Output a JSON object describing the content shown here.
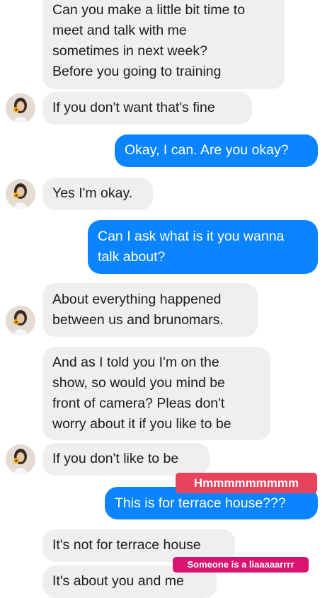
{
  "colors": {
    "incoming_bubble": "#efeff0",
    "outgoing_bubble": "#0a84ff",
    "sticker_red": "#e9425b",
    "sticker_pink": "#d9136e"
  },
  "messages": [
    {
      "from": "them",
      "text": "Can you make a little bit time to\nmeet and talk with me\nsometimes in next week?\nBefore you going to training"
    },
    {
      "from": "them",
      "text": "If you don't want that's fine"
    },
    {
      "from": "me",
      "text": "Okay, I can. Are you okay?"
    },
    {
      "from": "them",
      "text": "Yes I'm okay."
    },
    {
      "from": "me",
      "text": "Can I ask what is it you wanna\ntalk about?"
    },
    {
      "from": "them",
      "text": "About everything happened\nbetween us and brunomars."
    },
    {
      "from": "them",
      "text": "And as I told you I'm on the\nshow, so would you mind be\nfront of camera? Pleas don't\nworry about it if you like to be"
    },
    {
      "from": "them",
      "text": "If you don't like to be"
    },
    {
      "from": "me",
      "text": "This is for terrace house???"
    },
    {
      "from": "them",
      "text": "It's not for terrace house"
    },
    {
      "from": "them",
      "text": "It's about you and me"
    }
  ],
  "stickers": {
    "hmm": "Hmmmmmmmmm",
    "liar": "Someone is a liaaaaarrrr"
  },
  "avatar_icon": "contact-avatar-with-sunflower"
}
